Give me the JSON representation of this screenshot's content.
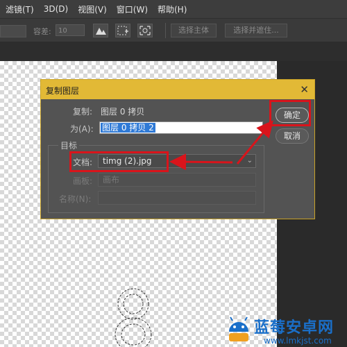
{
  "menu": [
    "滤镜(T)",
    "3D(D)",
    "视图(V)",
    "窗口(W)",
    "帮助(H)"
  ],
  "options_bar": {
    "tolerance_label": "容差:",
    "tolerance_value": "10",
    "select_subject": "选择主体",
    "select_and_mask": "选择并遮住..."
  },
  "dialog": {
    "title": "复制图层",
    "copy_label": "复制:",
    "copy_value": "图层 0 拷贝",
    "as_label": "为(A):",
    "as_value": "图层 0 拷贝 2",
    "target_group": "目标",
    "document_label": "文档:",
    "document_value": "timg (2).jpg",
    "artboard_label": "画板:",
    "artboard_value": "画布",
    "name_label": "名称(N):",
    "name_value": "",
    "ok_label": "确定",
    "cancel_label": "取消"
  },
  "watermark": {
    "title": "蓝莓安卓网",
    "url": "www.lmkjst.com"
  },
  "colors": {
    "title_bar": "#e2b936",
    "annotation_red": "#d9141b",
    "selection_blue": "#2f7ad6",
    "watermark_blue": "#1a6fc9"
  }
}
